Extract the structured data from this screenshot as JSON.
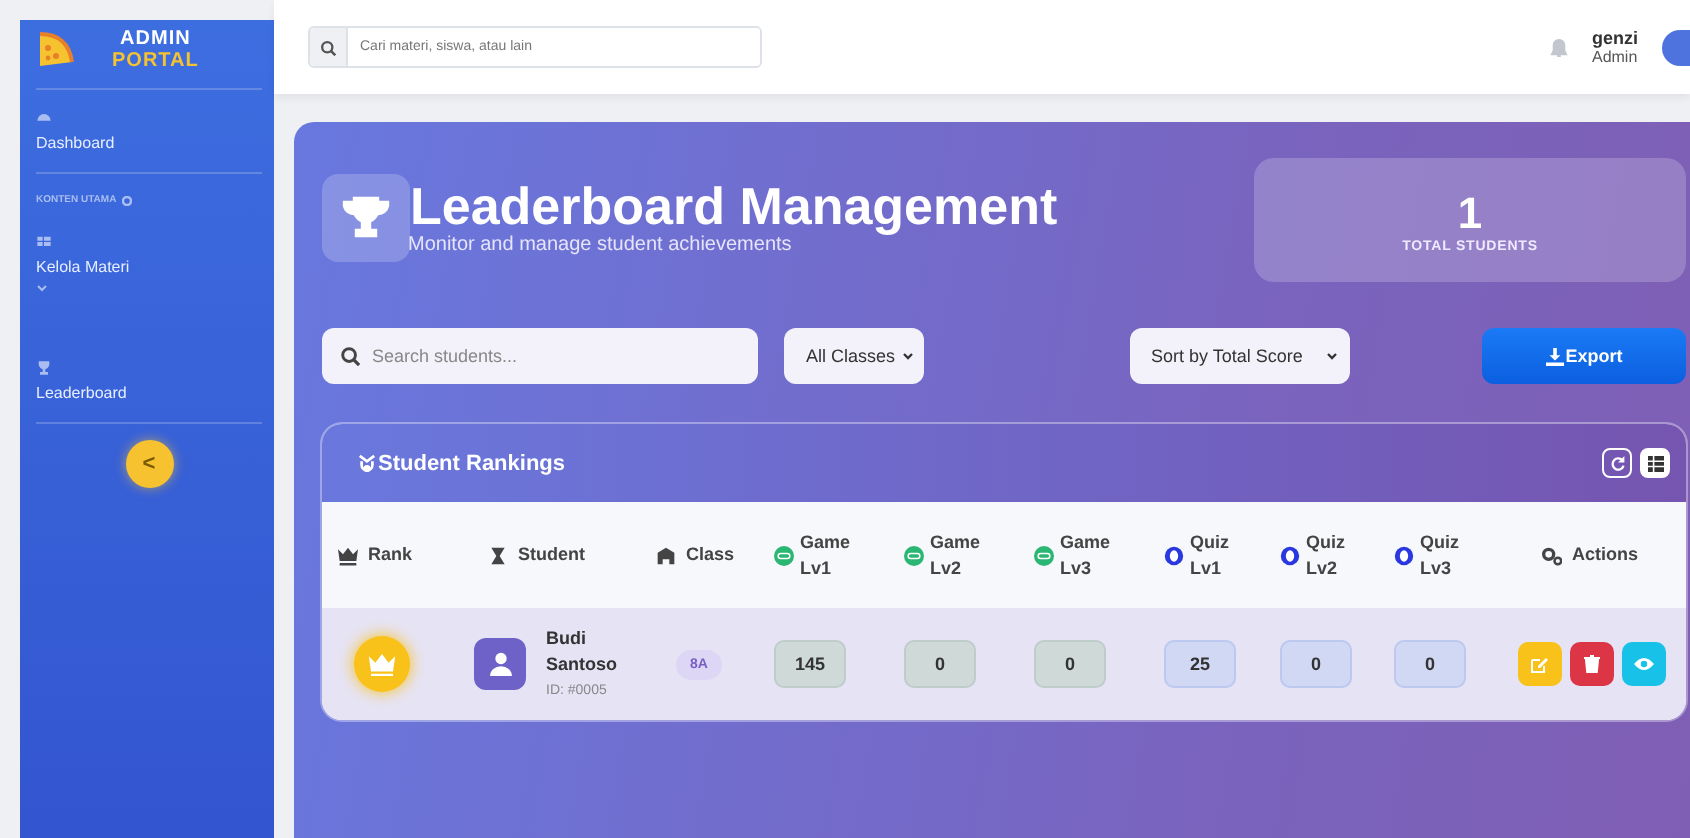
{
  "sidebar": {
    "brand_top": "ADMIN",
    "brand_bottom": "PORTAL",
    "items": [
      {
        "kind": "link",
        "label": "Dashboard"
      },
      {
        "kind": "heading",
        "label": "KONTEN UTAMA"
      },
      {
        "kind": "group",
        "label": "Kelola Materi",
        "expanded": false
      },
      {
        "kind": "link",
        "label": "Leaderboard"
      }
    ],
    "collapse_button": "<"
  },
  "topbar": {
    "search": {
      "placeholder": "Cari materi, siswa, atau lain"
    },
    "user": {
      "name": "genzi",
      "role": "Admin"
    }
  },
  "header": {
    "title": "Leaderboard Management",
    "subtitle": "Monitor and manage student achievements",
    "stat": {
      "value": "1",
      "label": "TOTAL STUDENTS"
    }
  },
  "filters": {
    "search": {
      "placeholder": "Search students..."
    },
    "class_select": "All Classes",
    "sort_select": "Sort by Total Score",
    "export": "Export"
  },
  "table": {
    "title": "Student Rankings",
    "columns": [
      {
        "kind": "rank",
        "label": "Rank"
      },
      {
        "kind": "student",
        "label": "Student"
      },
      {
        "kind": "class",
        "label": "Class"
      },
      {
        "kind": "game",
        "label": "Game Lv1"
      },
      {
        "kind": "game",
        "label": "Game Lv2"
      },
      {
        "kind": "game",
        "label": "Game Lv3"
      },
      {
        "kind": "quiz",
        "label": "Quiz Lv1"
      },
      {
        "kind": "quiz",
        "label": "Quiz Lv2"
      },
      {
        "kind": "quiz",
        "label": "Quiz Lv3"
      },
      {
        "kind": "actions",
        "label": "Actions"
      }
    ],
    "rows": [
      {
        "name": "Budi Santoso",
        "id": "ID: #0005",
        "class": "8A",
        "scores": [
          "145",
          "0",
          "0",
          "25",
          "0",
          "0"
        ]
      }
    ]
  }
}
